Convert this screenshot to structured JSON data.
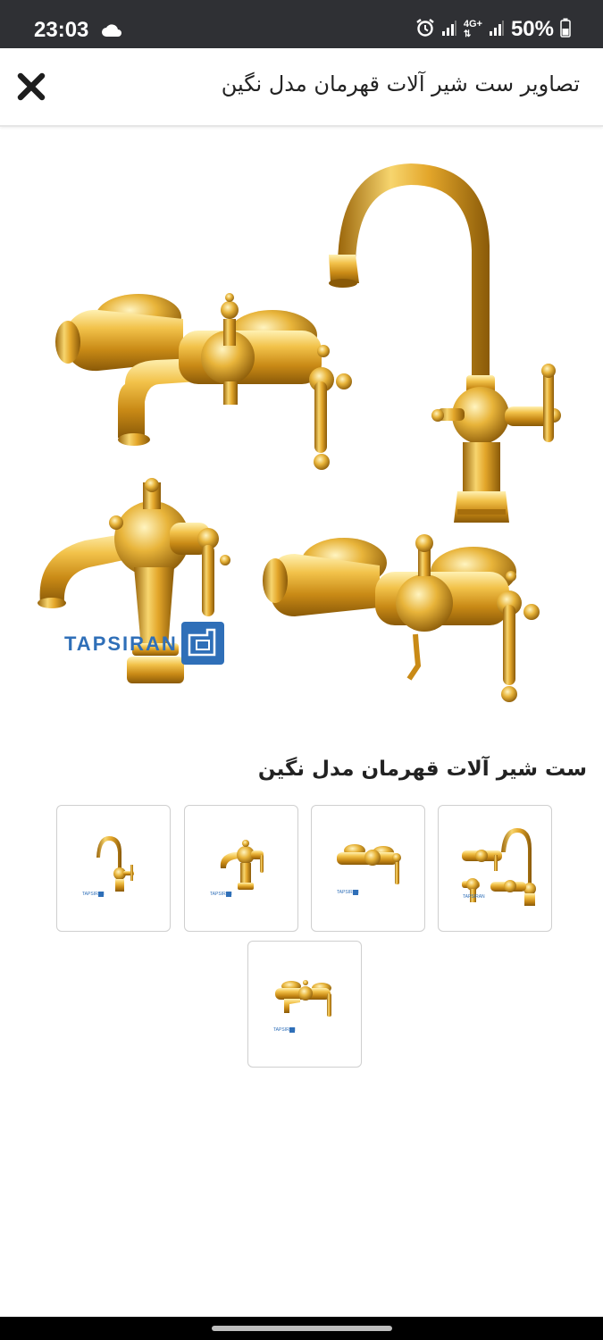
{
  "status_bar": {
    "time": "23:03",
    "cloud_icon": "cloud-icon",
    "network": "4G+",
    "battery": "50%"
  },
  "header": {
    "close_icon": "close-icon",
    "title": "تصاویر ست شیر آلات قهرمان مدل نگین"
  },
  "main_image": {
    "brand": "TAPSIRAN"
  },
  "product": {
    "title": "ست شیر آلات قهرمان مدل نگین"
  },
  "thumbnails": [
    {
      "name": "full-set",
      "brand": "TAPSIRAN"
    },
    {
      "name": "shower-mixer",
      "brand": "TAPSIRAN"
    },
    {
      "name": "basin-mixer",
      "brand": "TAPSIRAN"
    },
    {
      "name": "kitchen-mixer",
      "brand": "TAPSIRAN"
    },
    {
      "name": "bath-mixer",
      "brand": "TAPSIRAN"
    }
  ],
  "colors": {
    "gold": "#e0a92a",
    "gold_dark": "#a66e0c",
    "gold_light": "#fbe08a",
    "brand_blue": "#2f6fb8"
  }
}
